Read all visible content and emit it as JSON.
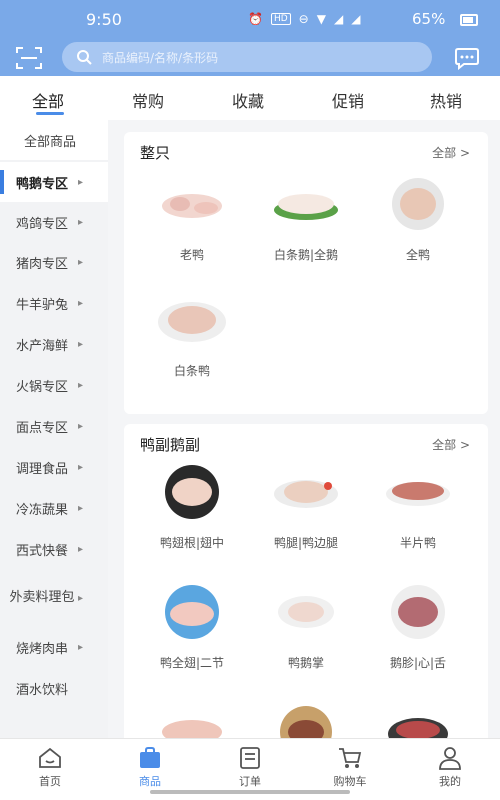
{
  "status_bar": {
    "time": "9:50",
    "battery": "65%"
  },
  "header": {
    "search_placeholder": "商品编码/名称/条形码"
  },
  "tabs": [
    {
      "label": "全部",
      "active": true
    },
    {
      "label": "常购"
    },
    {
      "label": "收藏"
    },
    {
      "label": "促销"
    },
    {
      "label": "热销"
    }
  ],
  "sidebar": {
    "items": [
      {
        "label": "全部商品",
        "arrow": ""
      },
      {
        "label": "鸭鹅专区",
        "arrow": "▸",
        "active": true
      },
      {
        "label": "鸡鸽专区",
        "arrow": "▸"
      },
      {
        "label": "猪肉专区",
        "arrow": "▸"
      },
      {
        "label": "牛羊驴兔",
        "arrow": "▸"
      },
      {
        "label": "水产海鲜",
        "arrow": "▸"
      },
      {
        "label": "火锅专区",
        "arrow": "▸"
      },
      {
        "label": "面点专区",
        "arrow": "▸"
      },
      {
        "label": "调理食品",
        "arrow": "▸"
      },
      {
        "label": "冷冻蔬果",
        "arrow": "▸"
      },
      {
        "label": "西式快餐",
        "arrow": "▸"
      },
      {
        "label": "外卖料理包",
        "arrow": "▸"
      },
      {
        "label": "烧烤肉串",
        "arrow": "▸"
      },
      {
        "label": "酒水饮料",
        "arrow": ""
      }
    ]
  },
  "sections": [
    {
      "title": "整只",
      "all_label": "全部 >",
      "products": [
        {
          "name": "老鸭"
        },
        {
          "name": "白条鹅|全鹅"
        },
        {
          "name": "全鸭"
        },
        {
          "name": "白条鸭"
        }
      ]
    },
    {
      "title": "鸭副鹅副",
      "all_label": "全部 >",
      "products": [
        {
          "name": "鸭翅根|翅中"
        },
        {
          "name": "鸭腿|鸭边腿"
        },
        {
          "name": "半片鸭"
        },
        {
          "name": "鸭全翅|二节"
        },
        {
          "name": "鸭鹅掌"
        },
        {
          "name": "鹅胗|心|舌"
        }
      ]
    }
  ],
  "bottom_nav": [
    {
      "label": "首页",
      "icon": "home-icon"
    },
    {
      "label": "商品",
      "icon": "goods-icon",
      "active": true
    },
    {
      "label": "订单",
      "icon": "order-icon"
    },
    {
      "label": "购物车",
      "icon": "cart-icon"
    },
    {
      "label": "我的",
      "icon": "user-icon"
    }
  ],
  "colors": {
    "brand_blue": "#7aa9e8",
    "accent": "#4a8ce8"
  }
}
